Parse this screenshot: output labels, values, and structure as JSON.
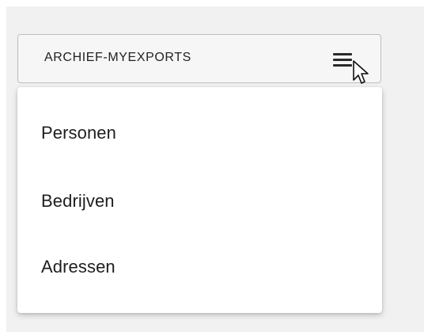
{
  "dropdown": {
    "label": "ARCHIEF-MYEXPORTS",
    "icon": "hamburger-menu-icon"
  },
  "menu": {
    "items": [
      {
        "label": "Personen"
      },
      {
        "label": "Bedrijven"
      },
      {
        "label": "Adressen"
      }
    ]
  },
  "colors": {
    "background": "#f1f1f1",
    "button_background": "#f6f6f6",
    "menu_background": "#ffffff",
    "text": "#1e1e1e"
  }
}
